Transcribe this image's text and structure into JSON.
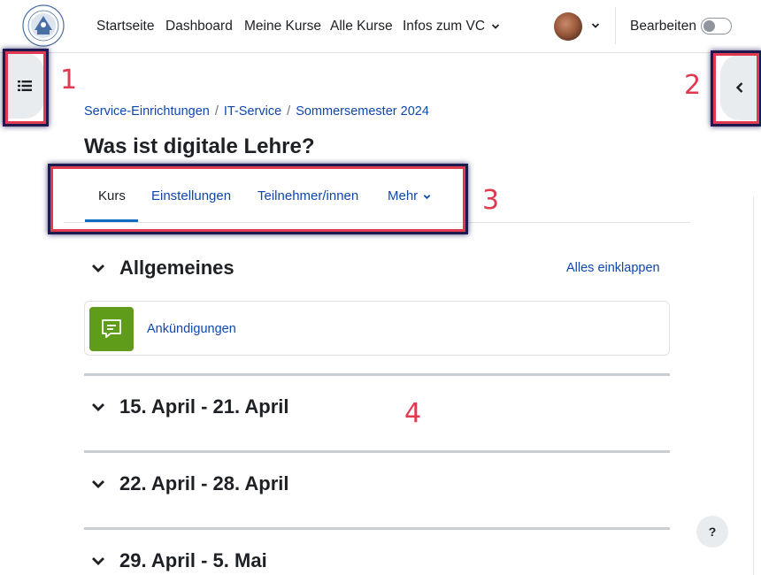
{
  "navbar": {
    "items": [
      "Startseite",
      "Dashboard",
      "Meine Kurse",
      "Alle Kurse",
      "Infos zum VC"
    ],
    "edit_mode_label": "Bearbeiten",
    "edit_mode_on": false
  },
  "breadcrumb": [
    "Service-Einrichtungen",
    "IT-Service",
    "Sommersemester 2024"
  ],
  "page_title": "Was ist digitale Lehre?",
  "secondary_nav": {
    "tabs": [
      "Kurs",
      "Einstellungen",
      "Teilnehmer/innen",
      "Mehr"
    ],
    "active": "Kurs"
  },
  "course": {
    "collapse_all": "Alles einklappen",
    "sections": [
      {
        "title": "Allgemeines",
        "activities": [
          {
            "name": "Ankündigungen",
            "icon": "forum-icon"
          }
        ]
      },
      {
        "title": "15. April - 21. April"
      },
      {
        "title": "22. April - 28. April"
      },
      {
        "title": "29. April - 5. Mai"
      }
    ]
  },
  "help_label": "?",
  "annotations": [
    "1",
    "2",
    "3",
    "4"
  ],
  "colors": {
    "link": "#0f47ad",
    "highlight": "#e03a50",
    "activity_icon_bg": "#5e9c1a"
  }
}
